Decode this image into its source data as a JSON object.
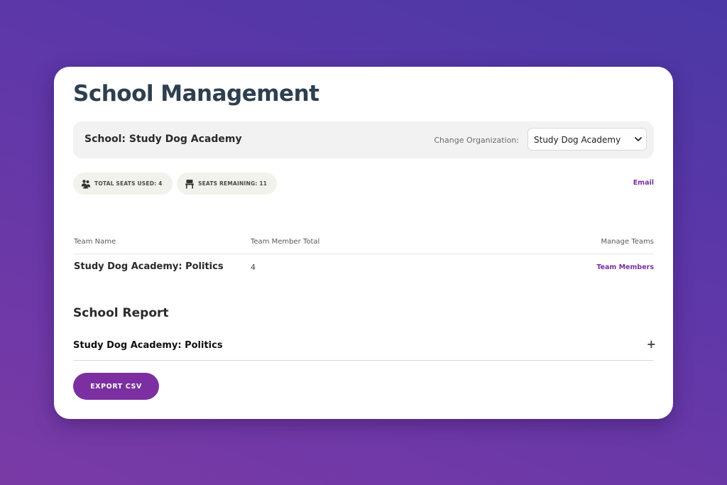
{
  "page": {
    "title": "School Management"
  },
  "school_bar": {
    "school_label": "School: Study Dog Academy",
    "change_org_label": "Change Organization:",
    "org_select": {
      "selected": "Study Dog Academy",
      "icon": "chevron-down-icon"
    }
  },
  "badges": {
    "seats_used": {
      "label": "TOTAL SEATS USED: 4",
      "icon": "users-icon"
    },
    "seats_remaining": {
      "label": "SEATS REMAINING: 11",
      "icon": "chair-icon"
    }
  },
  "email_link": "Email",
  "teams_table": {
    "columns": [
      "Team Name",
      "Team Member Total",
      "Manage Teams"
    ],
    "rows": [
      {
        "name": "Study Dog Academy: Politics",
        "total": "4",
        "action": "Team Members"
      }
    ]
  },
  "report": {
    "title": "School Report",
    "items": [
      {
        "title": "Study Dog Academy: Politics",
        "toggle": "+"
      }
    ],
    "export_label": "EXPORT CSV"
  },
  "colors": {
    "accent": "#7b2fa0",
    "title": "#2e3f4f",
    "badge_bg": "#f2f2ec",
    "school_bar_bg": "#f2f2f2"
  }
}
